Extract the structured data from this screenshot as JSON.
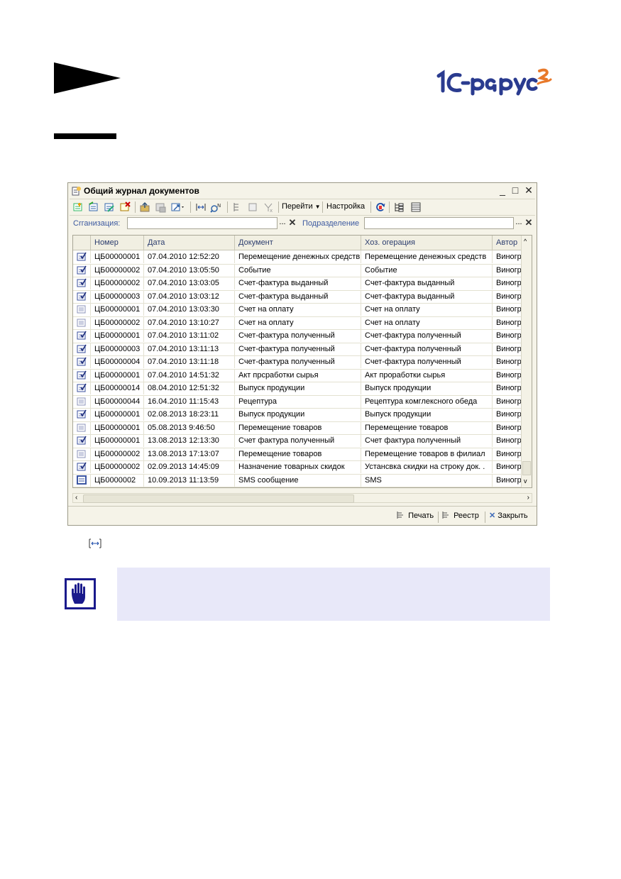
{
  "window": {
    "title": "Общий журнал документов"
  },
  "toolbar": {
    "goto_label": "Перейти",
    "settings_label": "Настройка"
  },
  "filters": {
    "org_label": "Сrганизация:",
    "org_value": "",
    "dept_label": "Подразделение",
    "dept_value": "",
    "dots": "..."
  },
  "grid": {
    "columns": [
      "Номер",
      "Дата",
      "Документ",
      "Хоз. огерация",
      "Автор"
    ],
    "rows": [
      {
        "icon": "posted-doc-icon",
        "num": "ЦБ00000001",
        "date": "07.04.2010 12:52:20",
        "doc": "Перемещение денежных средств",
        "op": "Перемещение денежных средств",
        "author": "Виногр"
      },
      {
        "icon": "posted-doc-icon",
        "num": "ЦБ00000002",
        "date": "07.04.2010 13:05:50",
        "doc": "Событие",
        "op": "Событие",
        "author": "Виногр"
      },
      {
        "icon": "posted-doc-icon",
        "num": "ЦБ00000002",
        "date": "07.04.2010 13:03:05",
        "doc": "Счет-фактура выданный",
        "op": "Счет-фактура выданный",
        "author": "Виногр"
      },
      {
        "icon": "posted-doc-icon",
        "num": "ЦБ00000003",
        "date": "07.04.2010 13:03:12",
        "doc": "Счет-фактура выданный",
        "op": "Счет-фактура выданный",
        "author": "Виногр"
      },
      {
        "icon": "doc-icon",
        "num": "ЦБ00000001",
        "date": "07.04.2010 13:03:30",
        "doc": "Счет на оплату",
        "op": "Счет на оплату",
        "author": "Виногр"
      },
      {
        "icon": "doc-icon",
        "num": "ЦБ00000002",
        "date": "07.04.2010 13:10:27",
        "doc": "Счет на оплату",
        "op": "Счет на оплату",
        "author": "Виногр"
      },
      {
        "icon": "posted-doc-icon",
        "num": "ЦБ00000001",
        "date": "07.04.2010 13:11:02",
        "doc": "Счет-фактура полученный",
        "op": "Счет-фактура полученный",
        "author": "Виногр"
      },
      {
        "icon": "posted-doc-icon",
        "num": "ЦБ00000003",
        "date": "07.04.2010 13:11:13",
        "doc": "Счет-фактура полученный",
        "op": "Счет-фактура полученный",
        "author": "Виногр"
      },
      {
        "icon": "posted-doc-icon",
        "num": "ЦБ00000004",
        "date": "07.04.2010 13:11:18",
        "doc": "Счет-фактура полученный",
        "op": "Счет-фактура полученный",
        "author": "Виногр"
      },
      {
        "icon": "posted-doc-icon",
        "num": "ЦБ00000001",
        "date": "07.04.2010 14:51:32",
        "doc": "Акт прсработки сырья",
        "op": "Акт проработки сырья",
        "author": "Виногр"
      },
      {
        "icon": "posted-doc-icon",
        "num": "ЦБ00000014",
        "date": "08.04.2010 12:51:32",
        "doc": "Выпуск продукции",
        "op": "Выпуск продукции",
        "author": "Виногр"
      },
      {
        "icon": "doc-icon",
        "num": "ЦБ00000044",
        "date": "16.04.2010 11:15:43",
        "doc": "Рецептура",
        "op": "Рецептура комглексного обеда",
        "author": "Виногр"
      },
      {
        "icon": "posted-doc-icon",
        "num": "ЦБ00000001",
        "date": "02.08.2013 18:23:11",
        "doc": "Выпуск продукции",
        "op": "Выпуск продукции",
        "author": "Виногр"
      },
      {
        "icon": "doc-icon",
        "num": "ЦБ00000001",
        "date": "05.08.2013 9:46:50",
        "doc": "Перемещение товаров",
        "op": "Перемещение товаров",
        "author": "Виногр"
      },
      {
        "icon": "posted-doc-icon",
        "num": "ЦБ00000001",
        "date": "13.08.2013 12:13:30",
        "doc": "Счет фактура полученный",
        "op": "Счет фактура полученный",
        "author": "Виногр"
      },
      {
        "icon": "doc-icon",
        "num": "ЦБ00000002",
        "date": "13.08.2013 17:13:07",
        "doc": "Перемещение товаров",
        "op": "Перемещение товаров в филиал",
        "author": "Виногр"
      },
      {
        "icon": "posted-doc-icon",
        "num": "ЦБ00000002",
        "date": "02.09.2013 14:45:09",
        "doc": "Назначение товарных скидок",
        "op": "Устансвка скидки на строку док. .",
        "author": "Виногр"
      },
      {
        "icon": "selected-doc-icon",
        "num": "ЦБ0000002",
        "date": "10.09.2013 11:13:59",
        "doc": "SMS сообщение",
        "op": "SMS",
        "author": "Виногр"
      }
    ]
  },
  "bottom": {
    "print_label": "Печать",
    "registry_label": "Реестр",
    "close_label": "Закрыть"
  },
  "colors": {
    "window_bg": "#f5f3e8",
    "note_bg": "#e8e8f9",
    "logo_blue": "#2a3b8f",
    "logo_orange": "#e8792a"
  }
}
